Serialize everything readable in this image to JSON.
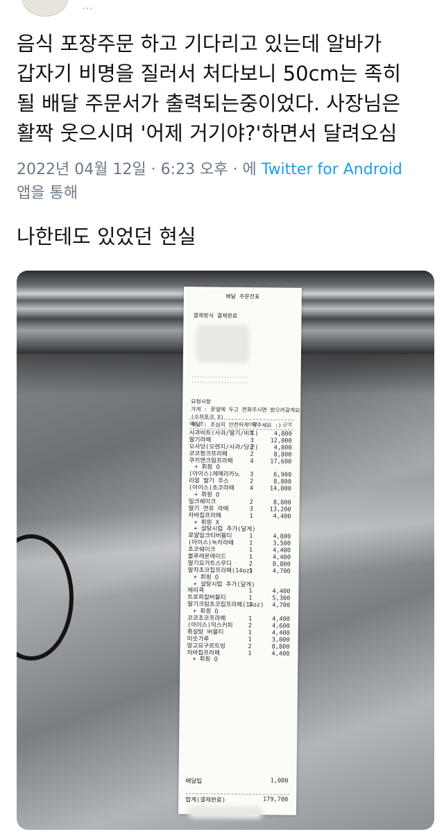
{
  "tweet": {
    "lines": [
      "음식 포장주문 하고 기다리고 있는데 알바가",
      "갑자기 비명을 질러서 처다보니 50cm는 족히",
      "될 배달 주문서가 출력되는중이었다. 사장님은",
      "활짝 웃으시며 '어제 거기야?'하면서 달려오심"
    ],
    "timestamp": "2022년 04월 12일 · 6:23 오후 · 에",
    "source": "Twitter for Android",
    "source_suffix": "앱을 통해"
  },
  "caption": "나한테도 있었던 현실",
  "receipt": {
    "title": "배달 주문전표",
    "payment": "결제방식 결제완료",
    "request_lines": [
      "요청사항",
      "가게 : 문앞에 두고 전화주시면 받으러갈게요",
      "(수저포크 X)",
      "배달 : 조심히 안전하게 와주세요 :)"
    ],
    "header": {
      "menu": "메뉴명",
      "qty": "수량",
      "price": "금액"
    },
    "items": [
      {
        "name": "사과비트(사과/딸기/비트)",
        "qty": "1",
        "price": "4,800"
      },
      {
        "name": "딸기라떼",
        "qty": "3",
        "price": "12,000"
      },
      {
        "name": "오사당(오렌지/사과/당근)",
        "qty": "1",
        "price": "4,800"
      },
      {
        "name": "코코펑크프라페",
        "qty": "2",
        "price": "8,800"
      },
      {
        "name": "쿠키앤크림프라페",
        "qty": "4",
        "price": "17,600"
      },
      {
        "name": "+ 휘핑 O",
        "qty": "",
        "price": "",
        "opt": true
      },
      {
        "name": "(아이스)에메리카노",
        "qty": "3",
        "price": "6,900"
      },
      {
        "name": "리얼 딸기 주스",
        "qty": "2",
        "price": "8,800"
      },
      {
        "name": "(아이스)초코라떼",
        "qty": "4",
        "price": "14,000"
      },
      {
        "name": "+ 휘핑 O",
        "qty": "",
        "price": "",
        "opt": true
      },
      {
        "name": "밀크쉐이크",
        "qty": "2",
        "price": "8,800"
      },
      {
        "name": "딸기 연유 라떼",
        "qty": "3",
        "price": "13,200"
      },
      {
        "name": "자바칩프라페",
        "qty": "1",
        "price": "4,400"
      },
      {
        "name": "+ 휘핑 X",
        "qty": "",
        "price": "",
        "opt": true
      },
      {
        "name": "+ 설탕시럽 추가(달게)",
        "qty": "",
        "price": "",
        "opt": true
      },
      {
        "name": "로얄밀크티버블티",
        "qty": "1",
        "price": "4,800"
      },
      {
        "name": "(아이스)녹차라떼",
        "qty": "1",
        "price": "3,500"
      },
      {
        "name": "초코쉐이크",
        "qty": "1",
        "price": "4,400"
      },
      {
        "name": "블루레몬에이드",
        "qty": "1",
        "price": "4,400"
      },
      {
        "name": "딸기요거트스무디",
        "qty": "2",
        "price": "8,800"
      },
      {
        "name": "말차초코칩프라페(14oz)",
        "qty": "1",
        "price": "4,700"
      },
      {
        "name": "+ 휘핑 O",
        "qty": "",
        "price": "",
        "opt": true
      },
      {
        "name": "+ 설탕시럽 추가(달게)",
        "qty": "",
        "price": "",
        "opt": true
      },
      {
        "name": "제리콕",
        "qty": "1",
        "price": "4,400"
      },
      {
        "name": "트로피칼버블티",
        "qty": "1",
        "price": "5,300"
      },
      {
        "name": "딸기크림초코칩프라페(14oz)",
        "qty": "1",
        "price": "4,700"
      },
      {
        "name": "+ 휘핑 O",
        "qty": "",
        "price": "",
        "opt": true
      },
      {
        "name": "코코초코프라페",
        "qty": "1",
        "price": "4,400"
      },
      {
        "name": "(아이스)믹스커피",
        "qty": "2",
        "price": "4,600"
      },
      {
        "name": "흑설탕 버블티",
        "qty": "1",
        "price": "4,400"
      },
      {
        "name": "미숫가루",
        "qty": "1",
        "price": "3,000"
      },
      {
        "name": "망고요구르트빙",
        "qty": "2",
        "price": "8,800"
      },
      {
        "name": "자바칩프라페",
        "qty": "1",
        "price": "4,400"
      },
      {
        "name": "+ 휘핑 O",
        "qty": "",
        "price": "",
        "opt": true
      }
    ],
    "delivery_tip": {
      "name": "배달팁",
      "price": "1,000"
    },
    "total": {
      "name": "합계(결제완료)",
      "price": "179,700"
    }
  }
}
